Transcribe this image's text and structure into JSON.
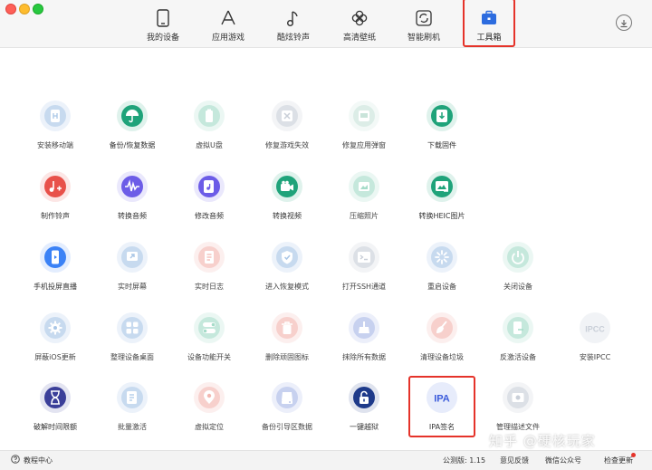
{
  "window": {
    "controls": [
      "close",
      "minimize",
      "maximize"
    ]
  },
  "nav": {
    "tabs": [
      {
        "label": "我的设备",
        "icon": "phone-icon"
      },
      {
        "label": "应用游戏",
        "icon": "app-store-icon"
      },
      {
        "label": "酷炫铃声",
        "icon": "music-note-icon"
      },
      {
        "label": "高清壁纸",
        "icon": "flower-icon"
      },
      {
        "label": "智能刷机",
        "icon": "refresh-icon"
      },
      {
        "label": "工具箱",
        "icon": "toolbox-icon",
        "active": true
      }
    ]
  },
  "tools": [
    {
      "label": "安装移动端",
      "icon": "app-install-icon",
      "color": "#a9c6e6",
      "dim": true
    },
    {
      "label": "备份/恢复数据",
      "icon": "umbrella-icon",
      "color": "#1fa37a"
    },
    {
      "label": "虚拟U盘",
      "icon": "usb-battery-icon",
      "color": "#a6dcc9",
      "dim": true
    },
    {
      "label": "修复游戏失效",
      "icon": "wrench-icon",
      "color": "#c9cfd8",
      "dim": true
    },
    {
      "label": "修复应用弹窗",
      "icon": "app-popup-icon",
      "color": "#c9e4da",
      "dim": true
    },
    {
      "label": "下载固件",
      "icon": "download-box-icon",
      "color": "#1fa37a"
    },
    {
      "label": "制作铃声",
      "icon": "music-add-icon",
      "color": "#e8514a"
    },
    {
      "label": "转换音频",
      "icon": "waveform-icon",
      "color": "#6c5ce7"
    },
    {
      "label": "修改音频",
      "icon": "audio-file-icon",
      "color": "#6c5ce7"
    },
    {
      "label": "转换视频",
      "icon": "video-camera-icon",
      "color": "#1fa37a"
    },
    {
      "label": "压缩照片",
      "icon": "photo-compress-icon",
      "color": "#a6dcc9",
      "dim": true
    },
    {
      "label": "转换HEIC图片",
      "icon": "photo-convert-icon",
      "color": "#1fa37a"
    },
    {
      "label": "手机投屏直播",
      "icon": "phone-screen-icon",
      "color": "#3b82f6"
    },
    {
      "label": "实时屏幕",
      "icon": "screen-share-icon",
      "color": "#a9c6e6",
      "dim": true
    },
    {
      "label": "实时日志",
      "icon": "log-file-icon",
      "color": "#f2b7b0",
      "dim": true
    },
    {
      "label": "进入恢复模式",
      "icon": "shield-icon",
      "color": "#a9c6e6",
      "dim": true
    },
    {
      "label": "打开SSH通道",
      "icon": "terminal-icon",
      "color": "#c9cfd8",
      "dim": true
    },
    {
      "label": "重启设备",
      "icon": "spinner-icon",
      "color": "#a9c6e6",
      "dim": true
    },
    {
      "label": "关闭设备",
      "icon": "power-icon",
      "color": "#a6dcc9",
      "dim": true
    },
    {
      "label": "屏蔽iOS更新",
      "icon": "gear-icon",
      "color": "#a9c6e6",
      "dim": true
    },
    {
      "label": "整理设备桌面",
      "icon": "grid-icon",
      "color": "#a9c6e6",
      "dim": true
    },
    {
      "label": "设备功能开关",
      "icon": "toggle-icon",
      "color": "#a6dcc9",
      "dim": true
    },
    {
      "label": "删除顽固图标",
      "icon": "trash-icon",
      "color": "#f2b7b0",
      "dim": true
    },
    {
      "label": "抹除所有数据",
      "icon": "eraser-icon",
      "color": "#a9b8e6",
      "dim": true
    },
    {
      "label": "清理设备垃圾",
      "icon": "broom-icon",
      "color": "#f2b7b0",
      "dim": true
    },
    {
      "label": "反激活设备",
      "icon": "phone-deactivate-icon",
      "color": "#a6dcc9",
      "dim": true
    },
    {
      "label": "安装IPCC",
      "icon": "ipcc-icon",
      "color": "#c9cfd8",
      "dim": true,
      "text": "IPCC"
    },
    {
      "label": "破解时间限额",
      "icon": "hourglass-icon",
      "color": "#3b3f99"
    },
    {
      "label": "批量激活",
      "icon": "batch-activate-icon",
      "color": "#a9c6e6",
      "dim": true
    },
    {
      "label": "虚拟定位",
      "icon": "location-pin-icon",
      "color": "#f2b7b0",
      "dim": true
    },
    {
      "label": "备份引导区数据",
      "icon": "disk-backup-icon",
      "color": "#a9b8e6",
      "dim": true
    },
    {
      "label": "一键越狱",
      "icon": "unlock-icon",
      "color": "#1e3a8a"
    },
    {
      "label": "IPA签名",
      "icon": "ipa-icon",
      "color": "#3b5bdb",
      "text": "IPA"
    },
    {
      "label": "管理描述文件",
      "icon": "profile-gear-icon",
      "color": "#c9cfd8",
      "dim": true
    }
  ],
  "footer": {
    "tutorial": "教程中心",
    "version": "公测版: 1.15",
    "feedback": "意见反馈",
    "wechat": "微信公众号",
    "update": "检查更新"
  },
  "watermark": "知乎 @硬核玩家"
}
